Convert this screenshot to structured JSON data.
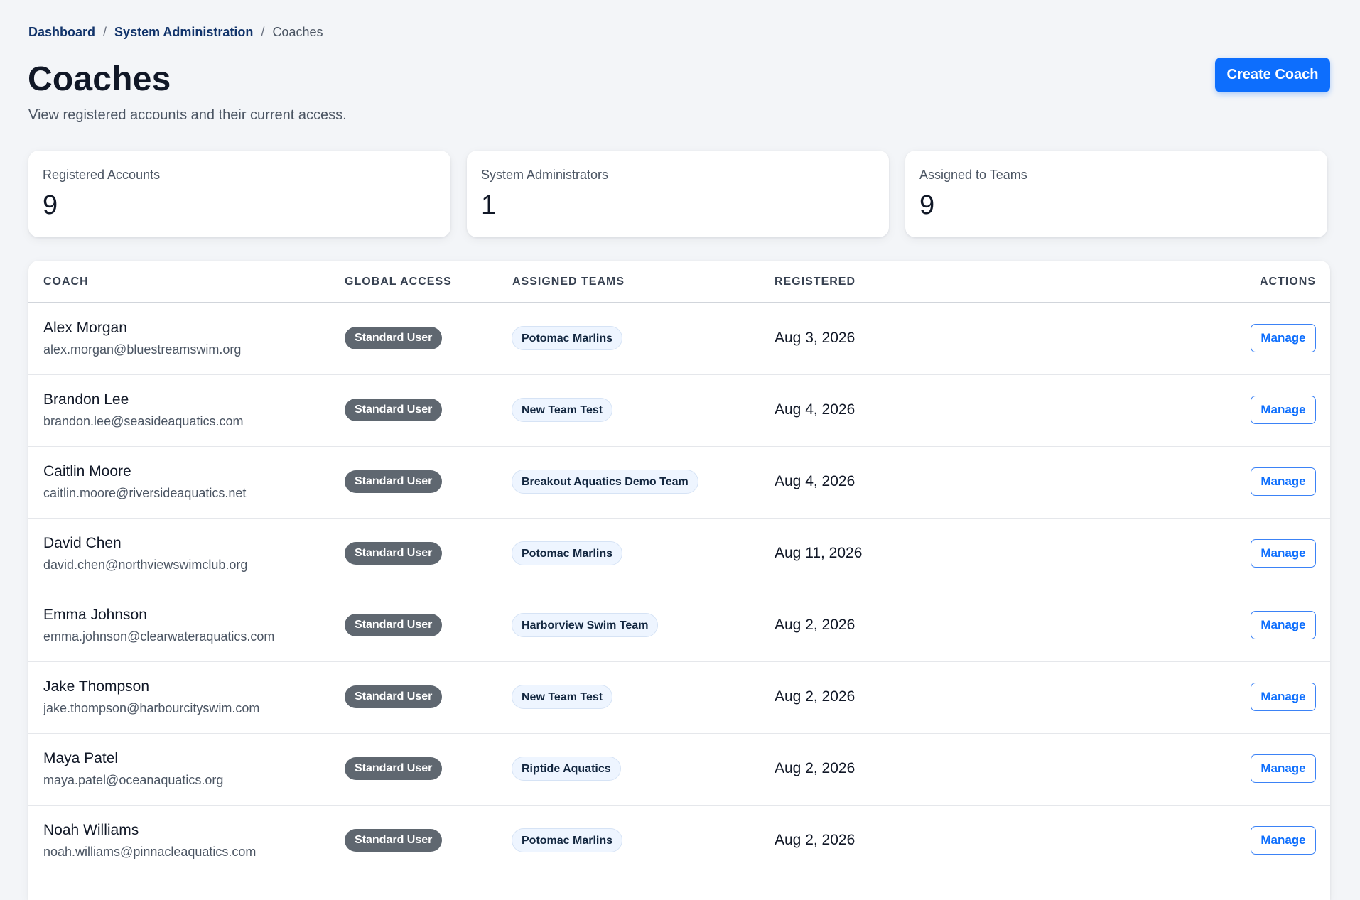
{
  "breadcrumb": {
    "items": [
      "Dashboard",
      "System Administration"
    ],
    "separator": "/",
    "current": "Coaches"
  },
  "header": {
    "title": "Coaches",
    "subtitle": "View registered accounts and their current access.",
    "create_label": "Create Coach"
  },
  "stats": [
    {
      "label": "Registered Accounts",
      "value": "9"
    },
    {
      "label": "System Administrators",
      "value": "1"
    },
    {
      "label": "Assigned to Teams",
      "value": "9"
    }
  ],
  "table": {
    "columns": [
      "COACH",
      "GLOBAL ACCESS",
      "ASSIGNED TEAMS",
      "REGISTERED",
      "ACTIONS"
    ],
    "action_label": "Manage",
    "rows": [
      {
        "name": "Alex Morgan",
        "email": "alex.morgan@bluestreamswim.org",
        "access": "Standard User",
        "team": "Potomac Marlins",
        "registered": "Aug 3, 2026"
      },
      {
        "name": "Brandon Lee",
        "email": "brandon.lee@seasideaquatics.com",
        "access": "Standard User",
        "team": "New Team Test",
        "registered": "Aug 4, 2026"
      },
      {
        "name": "Caitlin Moore",
        "email": "caitlin.moore@riversideaquatics.net",
        "access": "Standard User",
        "team": "Breakout Aquatics Demo Team",
        "registered": "Aug 4, 2026"
      },
      {
        "name": "David Chen",
        "email": "david.chen@northviewswimclub.org",
        "access": "Standard User",
        "team": "Potomac Marlins",
        "registered": "Aug 11, 2026"
      },
      {
        "name": "Emma Johnson",
        "email": "emma.johnson@clearwateraquatics.com",
        "access": "Standard User",
        "team": "Harborview Swim Team",
        "registered": "Aug 2, 2026"
      },
      {
        "name": "Jake Thompson",
        "email": "jake.thompson@harbourcityswim.com",
        "access": "Standard User",
        "team": "New Team Test",
        "registered": "Aug 2, 2026"
      },
      {
        "name": "Maya Patel",
        "email": "maya.patel@oceanaquatics.org",
        "access": "Standard User",
        "team": "Riptide Aquatics",
        "registered": "Aug 2, 2026"
      },
      {
        "name": "Noah Williams",
        "email": "noah.williams@pinnacleaquatics.com",
        "access": "Standard User",
        "team": "Potomac Marlins",
        "registered": "Aug 2, 2026"
      }
    ]
  }
}
